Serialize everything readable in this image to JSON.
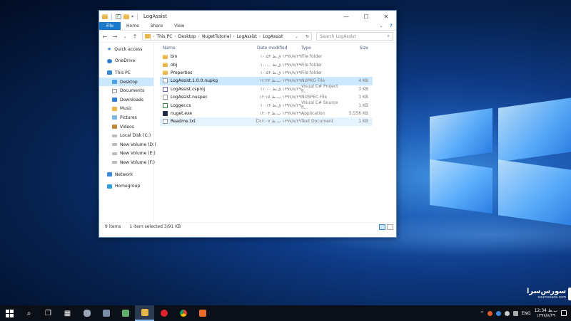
{
  "window": {
    "title": "LogAssist",
    "controls": {
      "minimize": "—",
      "maximize": "☐",
      "close": "✕"
    }
  },
  "ribbon": {
    "file": "File",
    "tabs": [
      "Home",
      "Share",
      "View"
    ],
    "expand": "⌄",
    "help": "?"
  },
  "address": {
    "crumbs": [
      "This PC",
      "Desktop",
      "NugetTutorial",
      "LogAssist",
      "LogAssist"
    ],
    "search_placeholder": "Search LogAssist"
  },
  "navpane": [
    {
      "label": "Quick access",
      "icon": "star-icon",
      "child": false,
      "selected": false,
      "gap": false
    },
    {
      "label": "OneDrive",
      "icon": "cloud-icon",
      "child": false,
      "selected": false,
      "gap": true
    },
    {
      "label": "This PC",
      "icon": "computer-icon",
      "child": false,
      "selected": false,
      "gap": true
    },
    {
      "label": "Desktop",
      "icon": "desktop-icon",
      "child": true,
      "selected": true,
      "gap": false
    },
    {
      "label": "Documents",
      "icon": "documents-icon",
      "child": true,
      "selected": false,
      "gap": false
    },
    {
      "label": "Downloads",
      "icon": "downloads-icon",
      "child": true,
      "selected": false,
      "gap": false
    },
    {
      "label": "Music",
      "icon": "music-icon",
      "child": true,
      "selected": false,
      "gap": false
    },
    {
      "label": "Pictures",
      "icon": "pictures-icon",
      "child": true,
      "selected": false,
      "gap": false
    },
    {
      "label": "Videos",
      "icon": "videos-icon",
      "child": true,
      "selected": false,
      "gap": false
    },
    {
      "label": "Local Disk (C:)",
      "icon": "drive-icon",
      "child": true,
      "selected": false,
      "gap": false
    },
    {
      "label": "New Volume (D:)",
      "icon": "drive-icon",
      "child": true,
      "selected": false,
      "gap": false
    },
    {
      "label": "New Volume (E:)",
      "icon": "drive-icon",
      "child": true,
      "selected": false,
      "gap": false
    },
    {
      "label": "New Volume (F:)",
      "icon": "drive-icon",
      "child": true,
      "selected": false,
      "gap": false
    },
    {
      "label": "Network",
      "icon": "network-icon",
      "child": false,
      "selected": false,
      "gap": true
    },
    {
      "label": "Homegroup",
      "icon": "homegroup-icon",
      "child": false,
      "selected": false,
      "gap": true
    }
  ],
  "columns": {
    "name": "Name",
    "date": "Date modified",
    "type": "Type",
    "size": "Size"
  },
  "files": [
    {
      "name": "bin",
      "date": "۱۳۹۷/۸/۲۹ ق.ظ ۱۰:۵۴",
      "type": "File folder",
      "size": "",
      "kind": "folder",
      "state": ""
    },
    {
      "name": "obj",
      "date": "۱۳۹۷/۸/۲۹ ق.ظ ۱۰:۰۰",
      "type": "File folder",
      "size": "",
      "kind": "folder",
      "state": ""
    },
    {
      "name": "Properties",
      "date": "۱۳۹۷/۸/۲۹ ق.ظ ۱۰:۵۴",
      "type": "File folder",
      "size": "",
      "kind": "folder",
      "state": ""
    },
    {
      "name": "LogAssist.1.0.0.nupkg",
      "date": "۱۳۹۷/۸/۲۹ ب.ظ ۱۲:۳۳",
      "type": "NUPKG File",
      "size": "4 KB",
      "kind": "pkg",
      "state": "sel"
    },
    {
      "name": "LogAssist.csproj",
      "date": "۱۳۹۷/۸/۲۹ ق.ظ ۱۱:۰۰",
      "type": "Visual C# Project fi...",
      "size": "3 KB",
      "kind": "proj",
      "state": ""
    },
    {
      "name": "LogAssist.nuspec",
      "date": "۱۳۹۷/۸/۲۹ ب.ظ ۱۲:۱۵",
      "type": "NUSPEC File",
      "size": "1 KB",
      "kind": "spec",
      "state": ""
    },
    {
      "name": "Logger.cs",
      "date": "۱۳۹۷/۸/۲۹ ق.ظ ۱۰:۱۴",
      "type": "Visual C# Source fi...",
      "size": "1 KB",
      "kind": "cs",
      "state": ""
    },
    {
      "name": "nuget.exe",
      "date": "۱۳۹۷/۸/۲۹ ب.ظ ۱۲:۰۴",
      "type": "Application",
      "size": "5,556 KB",
      "kind": "exe",
      "state": ""
    },
    {
      "name": "Readme.txt",
      "date": "۱۳۹۷/۸/۲۹ ب.ظ ۱۲:۰۷",
      "type": "Text Document",
      "size": "1 KB",
      "kind": "txt",
      "state": "hover"
    }
  ],
  "status": {
    "count": "9 items",
    "selected": "1 item selected  3/91 KB"
  },
  "watermark": {
    "fa": "سورس‌سرا",
    "en": "sourcesara.com"
  },
  "tray": {
    "lang": "ENG",
    "time": "12:34 ب.ظ",
    "date": "۱۳۹۷/۸/۲۹"
  }
}
